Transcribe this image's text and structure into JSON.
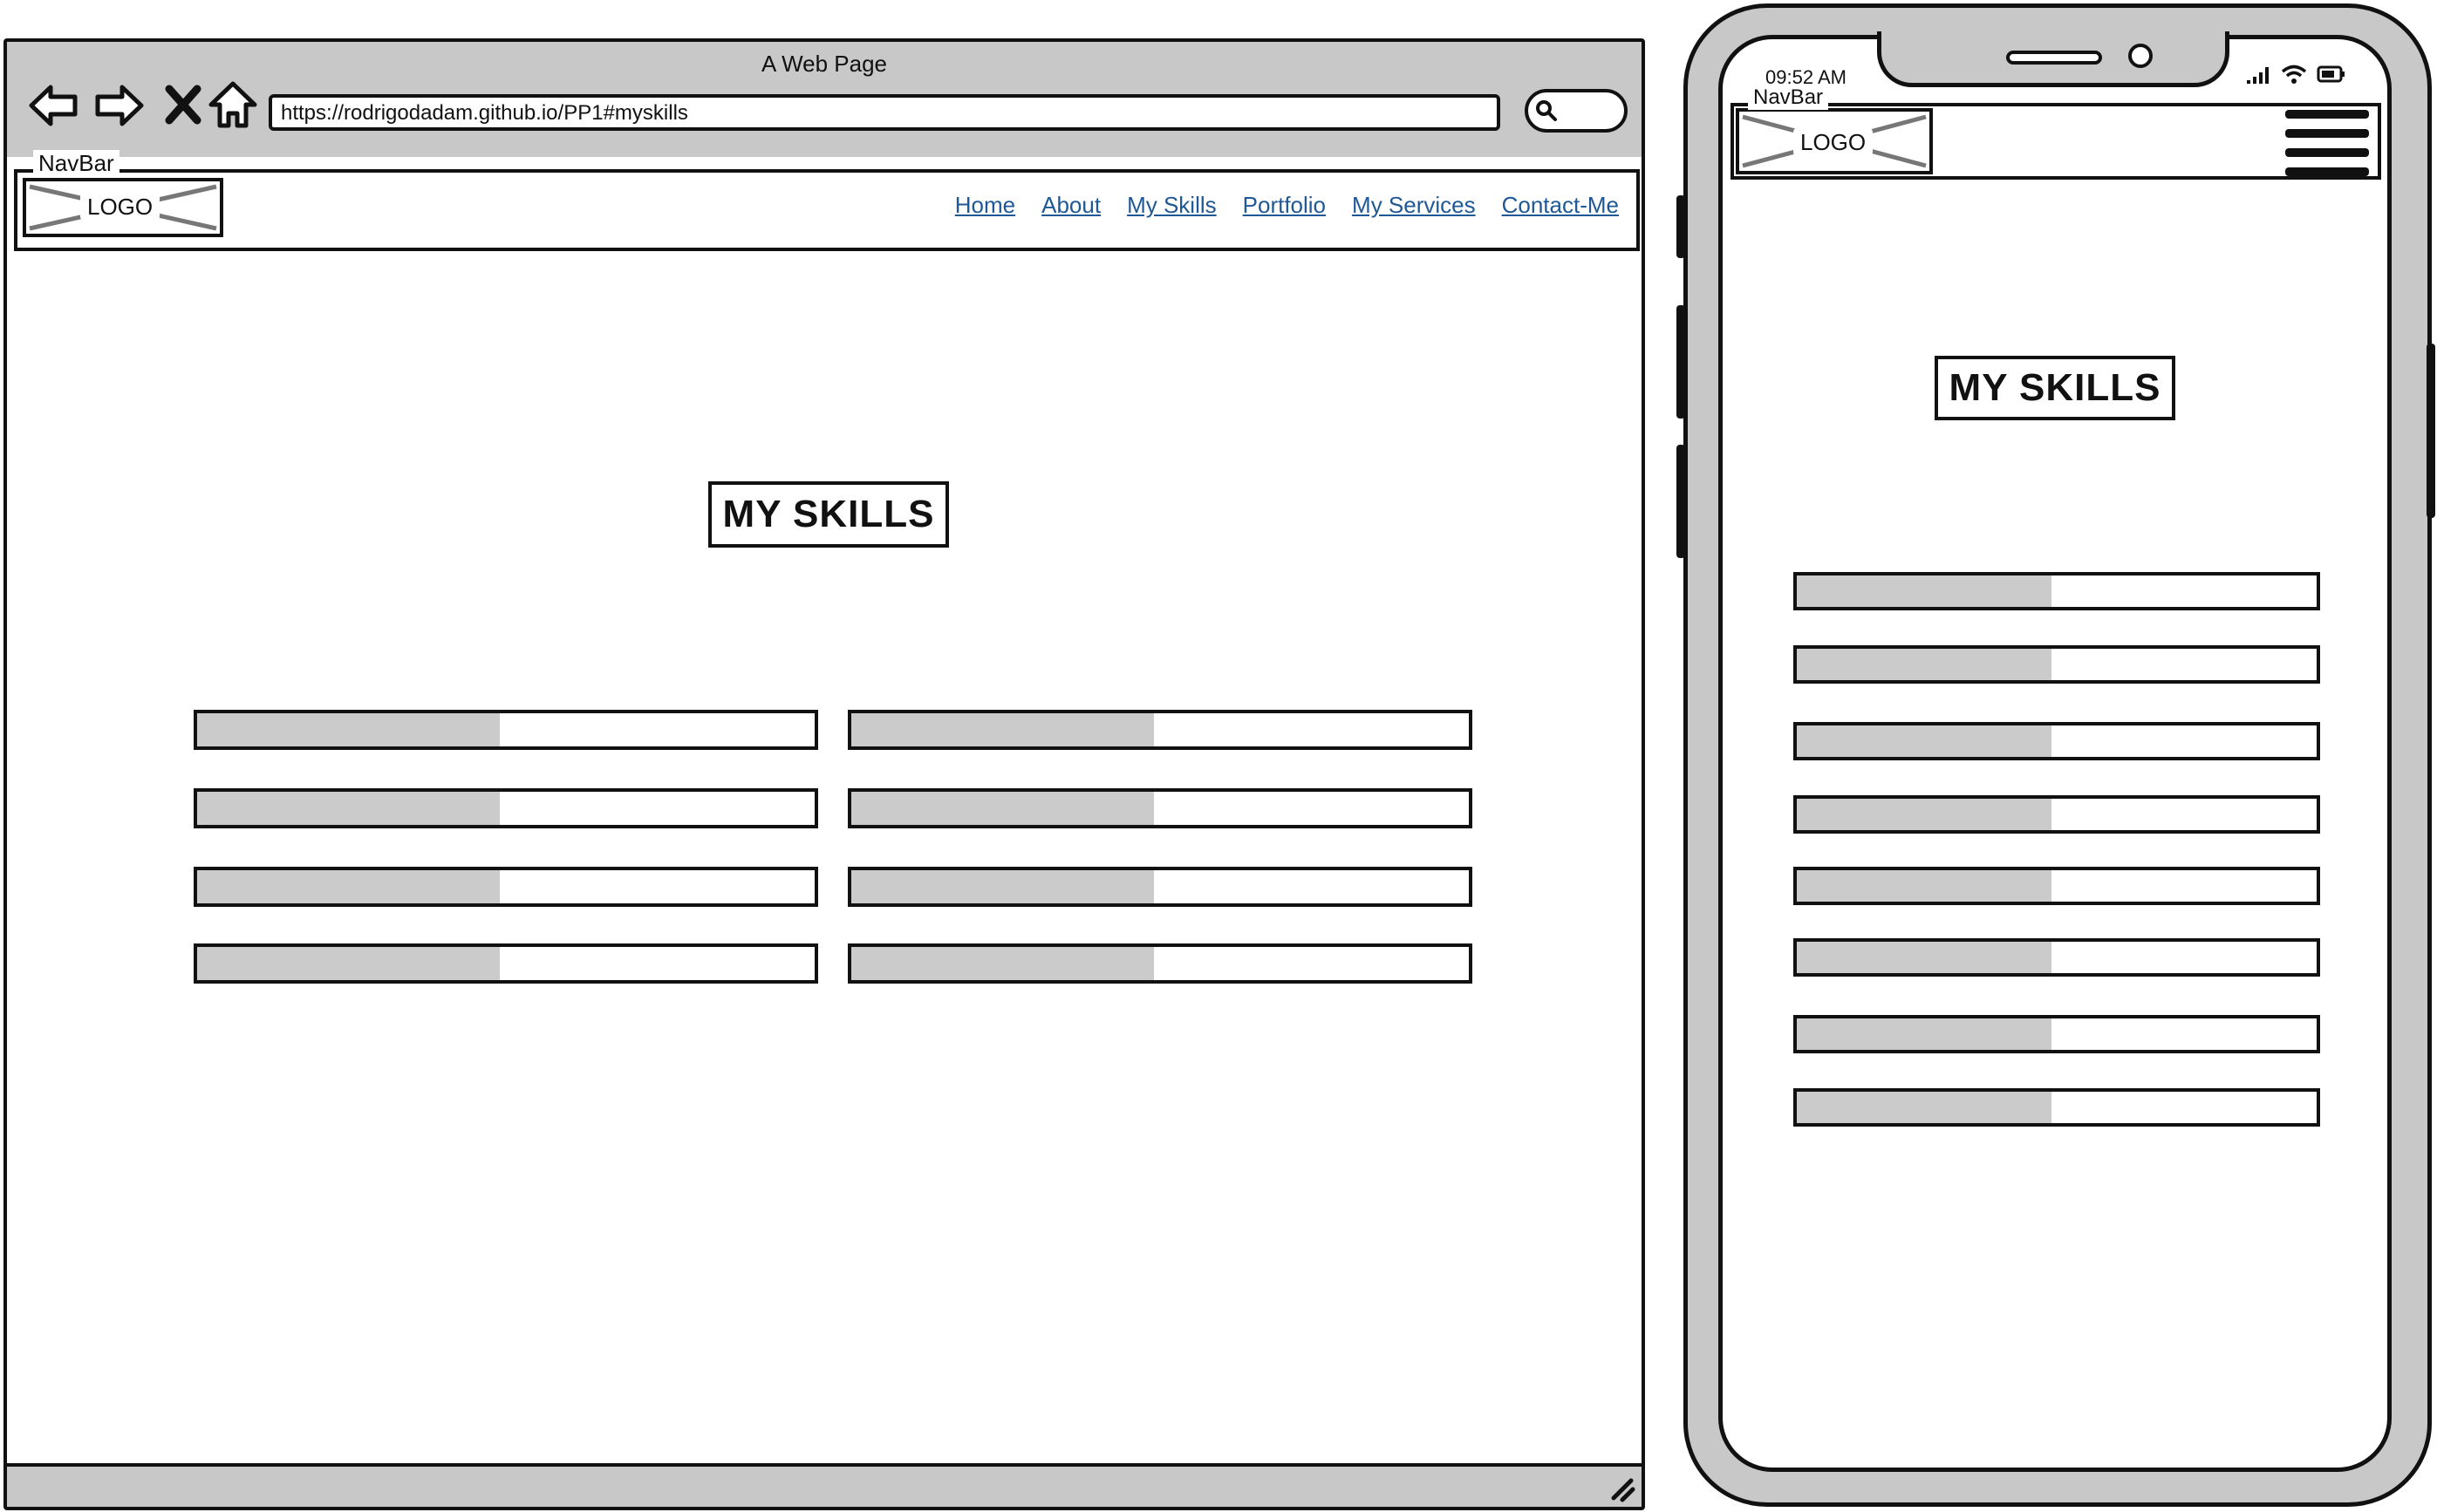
{
  "desktop": {
    "window_title": "A Web Page",
    "url": "https://rodrigodadam.github.io/PP1#myskills",
    "icons": [
      "back-arrow-icon",
      "forward-arrow-icon",
      "close-x-icon",
      "home-icon",
      "search-icon",
      "resize-grip-icon"
    ],
    "navbar": {
      "label": "NavBar",
      "logo": "LOGO",
      "links": [
        "Home",
        "About",
        "My Skills",
        "Portfolio",
        "My Services",
        "Contact-Me"
      ]
    },
    "section_title": "MY SKILLS",
    "skill_bars": {
      "left_column_fill": [
        0.49,
        0.49,
        0.49,
        0.49
      ],
      "right_column_fill": [
        0.49,
        0.49,
        0.49,
        0.49
      ]
    }
  },
  "mobile": {
    "status_time": "09:52 AM",
    "icons": [
      "signal-icon",
      "wifi-icon",
      "battery-icon",
      "hamburger-menu-icon"
    ],
    "navbar": {
      "label": "NavBar",
      "logo": "LOGO"
    },
    "section_title": "MY SKILLS",
    "skill_bars_fill": [
      0.49,
      0.49,
      0.49,
      0.49,
      0.49,
      0.49,
      0.49,
      0.49
    ]
  },
  "colors": {
    "link": "#1f5896",
    "chrome_gray": "#c8c8c8",
    "bar_fill": "#cbcbcb",
    "outline": "#111111"
  }
}
